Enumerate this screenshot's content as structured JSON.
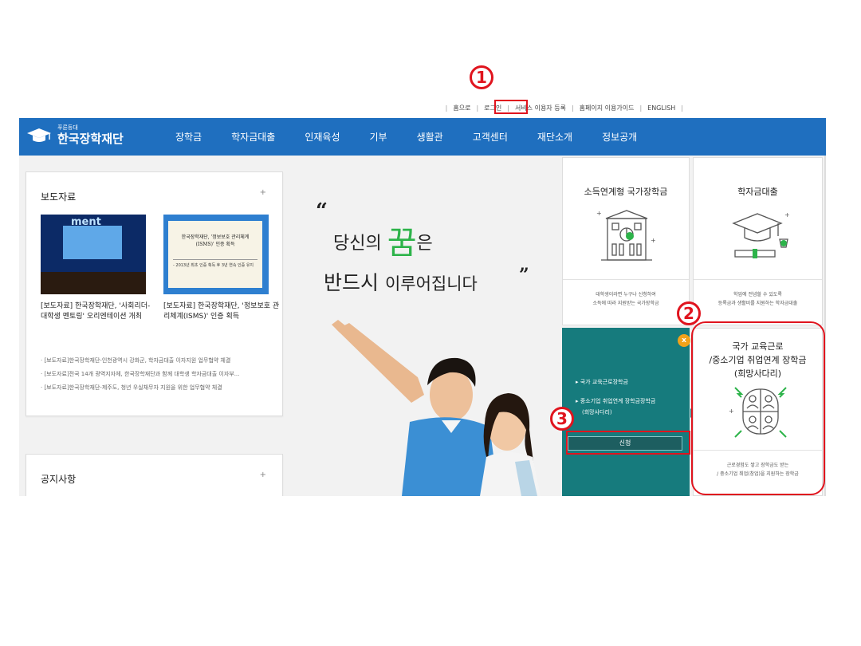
{
  "util_links": [
    "홈으로",
    "로그인",
    "서비스 이용자 등록",
    "홈페이지 이용가이드",
    "ENGLISH"
  ],
  "logo": {
    "small": "푸른등대",
    "name": "한국장학재단"
  },
  "menu": [
    "장학금",
    "학자금대출",
    "인재육성",
    "기부",
    "생활관",
    "고객센터",
    "재단소개",
    "정보공개"
  ],
  "news": {
    "title": "보도자료",
    "plus": "+",
    "thumb1_text": "ment",
    "thumb2_title": "한국장학재단, '정보보호 관리체계(ISMS)' 인증 획득",
    "thumb2_sub": "- 2013년 최초 인증 획득 후 3년 연속 인증 유지",
    "caption1": "[보도자료] 한국장학재단, '사회리더-대학생 멘토링' 오리엔테이션 개최",
    "caption2": "[보도자료] 한국장학재단, '정보보호 관리체계(ISMS)' 인증 획득",
    "items": [
      "· [보도자료]한국장학재단-인천광역시 강화군, 학자금대출 이자지원 업무협약 체결",
      "· [보도자료]전국 14개 광역지자체, 한국장학재단과 함께 대학생 학자금대출 이자부...",
      "· [보도자료]한국장학재단-제주도, 청년 우실채무자 지원을 위한 업무협약 체결"
    ]
  },
  "notice": {
    "title": "공지사항",
    "plus": "+"
  },
  "hero": {
    "quote_open": "“",
    "line1_a": "당신의 ",
    "line1_dream": "꿈",
    "line1_b": "은",
    "line2_a": "반드시 ",
    "line2_b": "이루어집니다",
    "quote_close": "”"
  },
  "box1": {
    "title": "소득연계형 국가장학금",
    "desc1": "대학생이라면 누구나 신청하여",
    "desc2": "소득에 따라 지원받는 국가장학금"
  },
  "box2": {
    "title": "학자금대출",
    "desc1": "학업에 전념할 수 있도록",
    "desc2": "등록금과 생활비를 지원하는 학자금대출"
  },
  "box3": {
    "title1": "국가 교육근로",
    "title2": "/중소기업 취업연계 장학금",
    "title3": "(희망사다리)",
    "desc1": "근로경험도 쌓고 장학금도 받는",
    "desc2": "/ 중소기업 취업(창업)을 지원하는 장학금"
  },
  "teal_panel": {
    "close": "x",
    "item1": "▸ 국가 교육근로장학금",
    "item2": "▸ 중소기업 취업연계 장학금장학금",
    "item2b": "(희망사다리)",
    "apply": "신청"
  },
  "annotations": [
    "1",
    "2",
    "3"
  ],
  "colors": {
    "nav": "#1f6fbf",
    "teal": "#167b7d",
    "annotation": "#e0141e",
    "dream": "#2db34a"
  }
}
